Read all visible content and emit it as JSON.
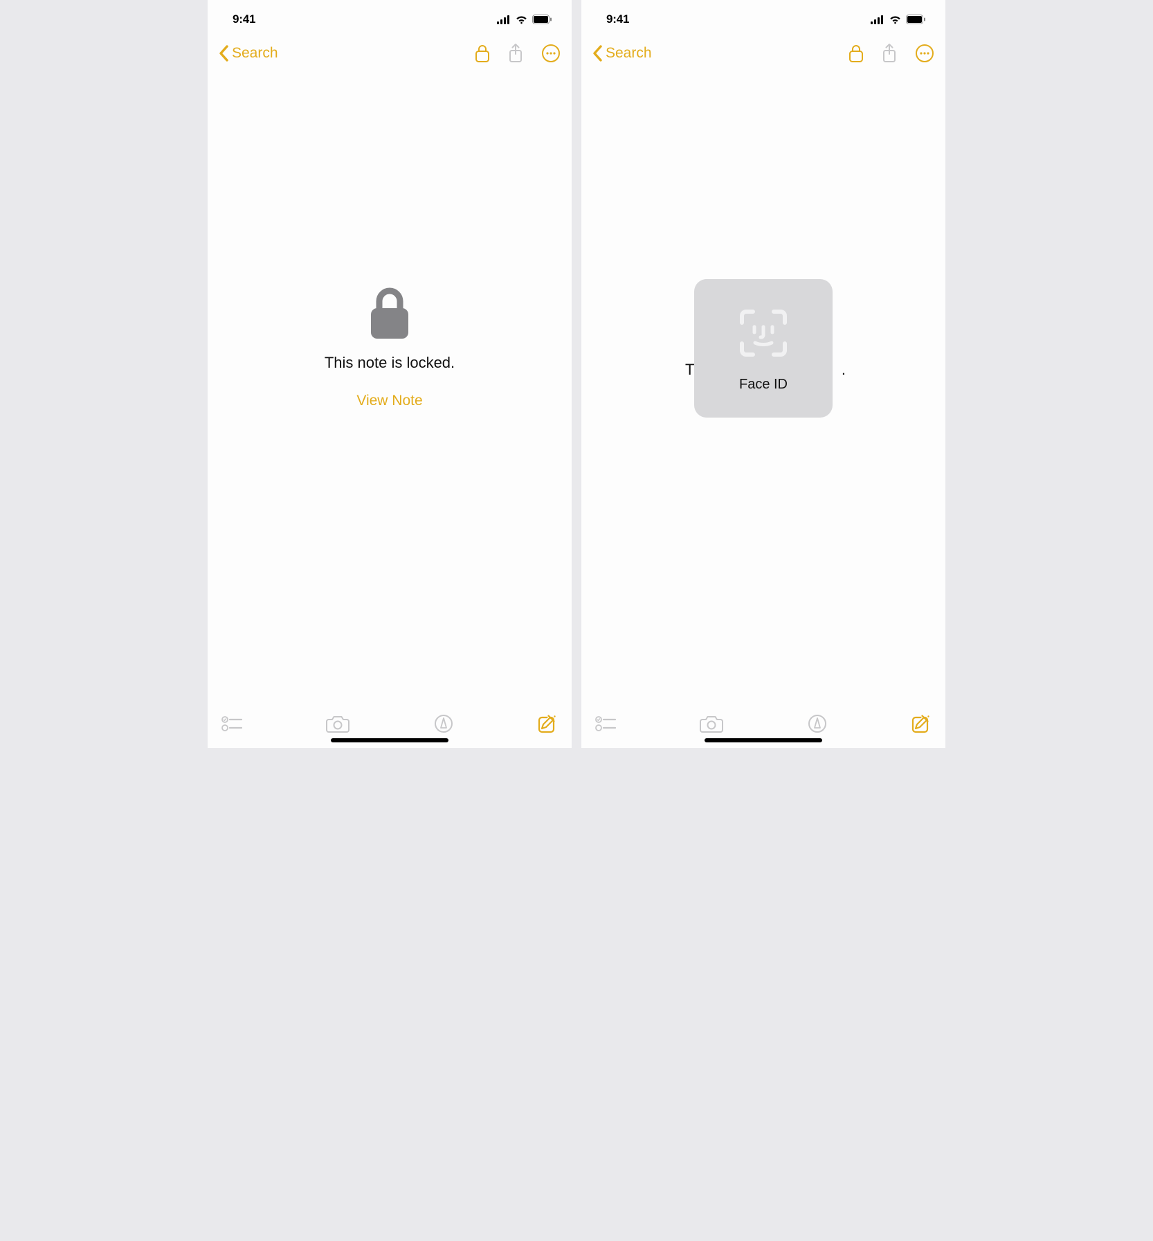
{
  "status": {
    "time": "9:41"
  },
  "nav": {
    "back_label": "Search"
  },
  "screen1": {
    "locked_message": "This note is locked.",
    "view_note_label": "View Note"
  },
  "screen2": {
    "faceid_label": "Face ID",
    "behind_left": "T",
    "behind_right": "."
  },
  "colors": {
    "accent": "#e3ac1c",
    "disabled": "#c7c7c9",
    "lock_gray": "#848487"
  }
}
